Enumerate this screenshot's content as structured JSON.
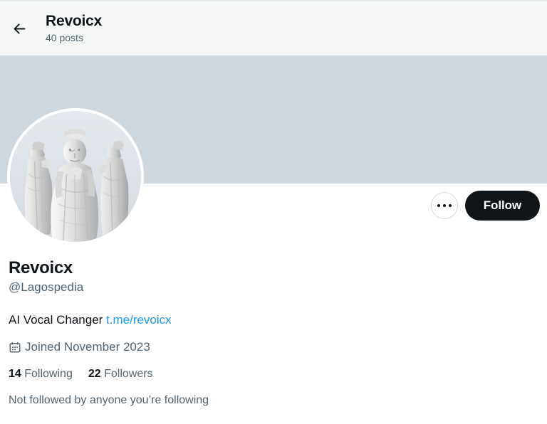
{
  "header": {
    "back_icon": "arrow-left-icon",
    "title": "Revoicx",
    "posts_count": "40 posts"
  },
  "banner": {
    "color": "#ced6de"
  },
  "avatar": {
    "alt": "three marble statues in robes",
    "background": "#dfe4ea"
  },
  "actions": {
    "more_icon": "ellipsis-icon",
    "follow_label": "Follow"
  },
  "profile": {
    "display_name": "Revoicx",
    "handle": "@Lagospedia",
    "bio_text": "AI Vocal Changer ",
    "bio_link": "t.me/revoicx",
    "joined_icon": "calendar-icon",
    "joined": "Joined November 2023",
    "following_count": "14",
    "following_label": "Following",
    "followers_count": "22",
    "followers_label": "Followers",
    "followed_by": "Not followed by anyone you’re following"
  },
  "colors": {
    "accent_link": "#1d9bf0",
    "text_primary": "#0f1419",
    "text_secondary": "#536471",
    "header_bg": "#f7f9f9",
    "follow_bg": "#0f1419"
  }
}
